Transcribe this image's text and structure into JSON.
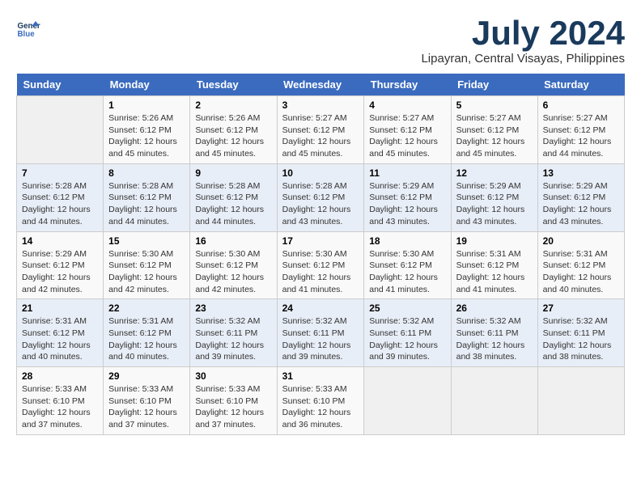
{
  "logo": {
    "line1": "General",
    "line2": "Blue"
  },
  "title": "July 2024",
  "subtitle": "Lipayran, Central Visayas, Philippines",
  "weekdays": [
    "Sunday",
    "Monday",
    "Tuesday",
    "Wednesday",
    "Thursday",
    "Friday",
    "Saturday"
  ],
  "weeks": [
    [
      {
        "day": "",
        "content": ""
      },
      {
        "day": "1",
        "content": "Sunrise: 5:26 AM\nSunset: 6:12 PM\nDaylight: 12 hours\nand 45 minutes."
      },
      {
        "day": "2",
        "content": "Sunrise: 5:26 AM\nSunset: 6:12 PM\nDaylight: 12 hours\nand 45 minutes."
      },
      {
        "day": "3",
        "content": "Sunrise: 5:27 AM\nSunset: 6:12 PM\nDaylight: 12 hours\nand 45 minutes."
      },
      {
        "day": "4",
        "content": "Sunrise: 5:27 AM\nSunset: 6:12 PM\nDaylight: 12 hours\nand 45 minutes."
      },
      {
        "day": "5",
        "content": "Sunrise: 5:27 AM\nSunset: 6:12 PM\nDaylight: 12 hours\nand 45 minutes."
      },
      {
        "day": "6",
        "content": "Sunrise: 5:27 AM\nSunset: 6:12 PM\nDaylight: 12 hours\nand 44 minutes."
      }
    ],
    [
      {
        "day": "7",
        "content": "Sunrise: 5:28 AM\nSunset: 6:12 PM\nDaylight: 12 hours\nand 44 minutes."
      },
      {
        "day": "8",
        "content": "Sunrise: 5:28 AM\nSunset: 6:12 PM\nDaylight: 12 hours\nand 44 minutes."
      },
      {
        "day": "9",
        "content": "Sunrise: 5:28 AM\nSunset: 6:12 PM\nDaylight: 12 hours\nand 44 minutes."
      },
      {
        "day": "10",
        "content": "Sunrise: 5:28 AM\nSunset: 6:12 PM\nDaylight: 12 hours\nand 43 minutes."
      },
      {
        "day": "11",
        "content": "Sunrise: 5:29 AM\nSunset: 6:12 PM\nDaylight: 12 hours\nand 43 minutes."
      },
      {
        "day": "12",
        "content": "Sunrise: 5:29 AM\nSunset: 6:12 PM\nDaylight: 12 hours\nand 43 minutes."
      },
      {
        "day": "13",
        "content": "Sunrise: 5:29 AM\nSunset: 6:12 PM\nDaylight: 12 hours\nand 43 minutes."
      }
    ],
    [
      {
        "day": "14",
        "content": "Sunrise: 5:29 AM\nSunset: 6:12 PM\nDaylight: 12 hours\nand 42 minutes."
      },
      {
        "day": "15",
        "content": "Sunrise: 5:30 AM\nSunset: 6:12 PM\nDaylight: 12 hours\nand 42 minutes."
      },
      {
        "day": "16",
        "content": "Sunrise: 5:30 AM\nSunset: 6:12 PM\nDaylight: 12 hours\nand 42 minutes."
      },
      {
        "day": "17",
        "content": "Sunrise: 5:30 AM\nSunset: 6:12 PM\nDaylight: 12 hours\nand 41 minutes."
      },
      {
        "day": "18",
        "content": "Sunrise: 5:30 AM\nSunset: 6:12 PM\nDaylight: 12 hours\nand 41 minutes."
      },
      {
        "day": "19",
        "content": "Sunrise: 5:31 AM\nSunset: 6:12 PM\nDaylight: 12 hours\nand 41 minutes."
      },
      {
        "day": "20",
        "content": "Sunrise: 5:31 AM\nSunset: 6:12 PM\nDaylight: 12 hours\nand 40 minutes."
      }
    ],
    [
      {
        "day": "21",
        "content": "Sunrise: 5:31 AM\nSunset: 6:12 PM\nDaylight: 12 hours\nand 40 minutes."
      },
      {
        "day": "22",
        "content": "Sunrise: 5:31 AM\nSunset: 6:12 PM\nDaylight: 12 hours\nand 40 minutes."
      },
      {
        "day": "23",
        "content": "Sunrise: 5:32 AM\nSunset: 6:11 PM\nDaylight: 12 hours\nand 39 minutes."
      },
      {
        "day": "24",
        "content": "Sunrise: 5:32 AM\nSunset: 6:11 PM\nDaylight: 12 hours\nand 39 minutes."
      },
      {
        "day": "25",
        "content": "Sunrise: 5:32 AM\nSunset: 6:11 PM\nDaylight: 12 hours\nand 39 minutes."
      },
      {
        "day": "26",
        "content": "Sunrise: 5:32 AM\nSunset: 6:11 PM\nDaylight: 12 hours\nand 38 minutes."
      },
      {
        "day": "27",
        "content": "Sunrise: 5:32 AM\nSunset: 6:11 PM\nDaylight: 12 hours\nand 38 minutes."
      }
    ],
    [
      {
        "day": "28",
        "content": "Sunrise: 5:33 AM\nSunset: 6:10 PM\nDaylight: 12 hours\nand 37 minutes."
      },
      {
        "day": "29",
        "content": "Sunrise: 5:33 AM\nSunset: 6:10 PM\nDaylight: 12 hours\nand 37 minutes."
      },
      {
        "day": "30",
        "content": "Sunrise: 5:33 AM\nSunset: 6:10 PM\nDaylight: 12 hours\nand 37 minutes."
      },
      {
        "day": "31",
        "content": "Sunrise: 5:33 AM\nSunset: 6:10 PM\nDaylight: 12 hours\nand 36 minutes."
      },
      {
        "day": "",
        "content": ""
      },
      {
        "day": "",
        "content": ""
      },
      {
        "day": "",
        "content": ""
      }
    ]
  ]
}
